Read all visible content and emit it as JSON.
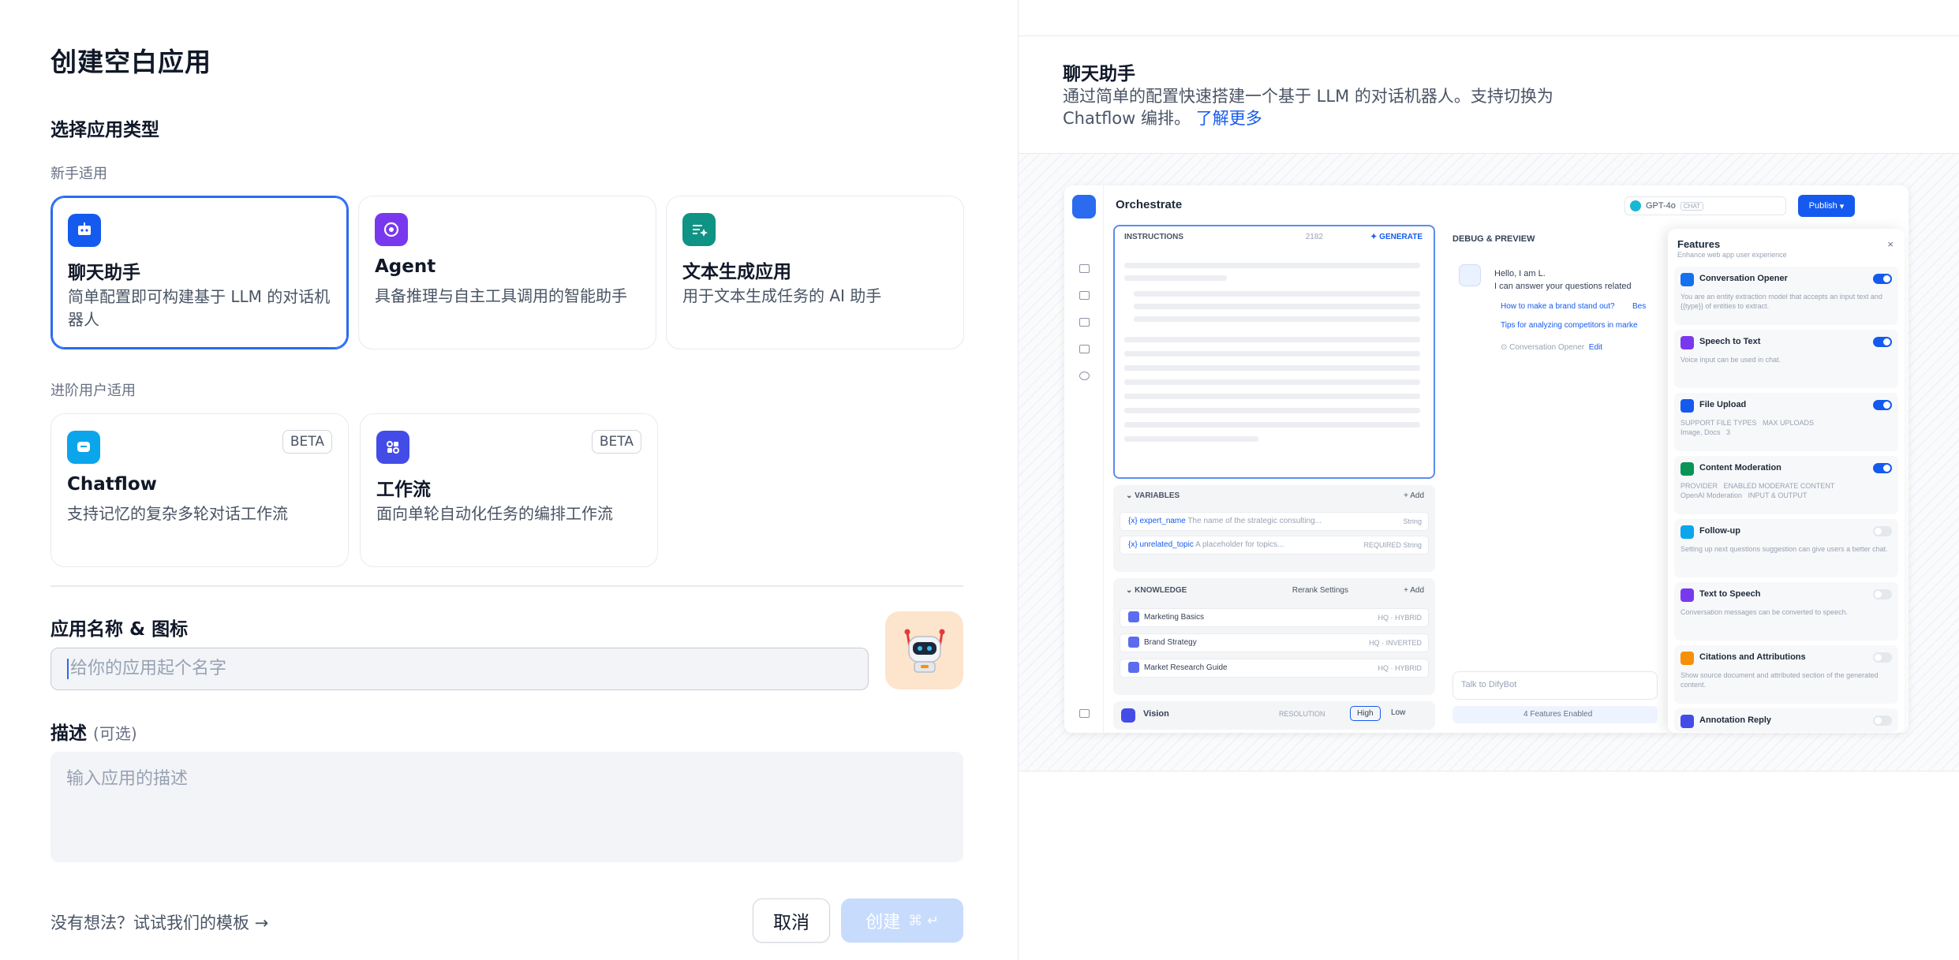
{
  "dialog": {
    "title": "创建空白应用",
    "type_heading": "选择应用类型",
    "group_beginner": "新手适用",
    "group_advanced": "进阶用户适用",
    "beta": "BETA",
    "cards": [
      {
        "title": "聊天助手",
        "desc": "简单配置即可构建基于 LLM 的对话机器人",
        "color": "#155aef",
        "icon": "chat-bot-icon"
      },
      {
        "title": "Agent",
        "desc": "具备推理与自主工具调用的智能助手",
        "color": "#7839ee",
        "icon": "agent-icon"
      },
      {
        "title": "文本生成应用",
        "desc": "用于文本生成任务的 AI 助手",
        "color": "#0e9384",
        "icon": "text-generation-icon"
      },
      {
        "title": "Chatflow",
        "desc": "支持记忆的复杂多轮对话工作流",
        "color": "#0ba5ec",
        "icon": "chatflow-icon"
      },
      {
        "title": "工作流",
        "desc": "面向单轮自动化任务的编排工作流",
        "color": "#444ce7",
        "icon": "workflow-icon"
      }
    ],
    "name_label": "应用名称 & 图标",
    "name_placeholder": "给你的应用起个名字",
    "desc_label": "描述",
    "desc_optional": "(可选)",
    "desc_placeholder": "输入应用的描述",
    "template_link": "没有想法？试试我们的模板",
    "cancel": "取消",
    "create": "创建",
    "create_shortcut": "⌘ ↵"
  },
  "preview": {
    "title": "聊天助手",
    "desc": "通过简单的配置快速搭建一个基于 LLM 的对话机器人。支持切换为 Chatflow 编排。",
    "learn_more": "了解更多",
    "mock": {
      "header_title": "Orchestrate",
      "model": "GPT-4o",
      "model_tag": "CHAT",
      "publish": "Publish",
      "instructions": "INSTRUCTIONS",
      "instructions_count": "2182",
      "generate": "GENERATE",
      "variables": "VARIABLES",
      "add": "+ Add",
      "vars": [
        {
          "key": "{x} expert_name",
          "desc": "The name of the strategic consulting...",
          "type": "String"
        },
        {
          "key": "{x} unrelated_topic",
          "desc": "A placeholder for topics...",
          "type": "String",
          "req": "REQUIRED"
        }
      ],
      "knowledge": "KNOWLEDGE",
      "rerank": "Rerank Settings",
      "kb": [
        {
          "name": "Marketing Basics",
          "tag": "HQ · HYBRID"
        },
        {
          "name": "Brand Strategy",
          "tag": "HQ · INVERTED"
        },
        {
          "name": "Market Research Guide",
          "tag": "HQ · HYBRID"
        }
      ],
      "vision": "Vision",
      "resolution": "RESOLUTION",
      "high": "High",
      "low": "Low",
      "debug": "DEBUG & PREVIEW",
      "hello1": "Hello, I am L.",
      "hello2": "I can answer your questions related",
      "q1": "How to make a brand stand out?",
      "q1b": "Bes",
      "q2": "Tips for analyzing competitors in marke",
      "opener": "Conversation Opener",
      "edit": "Edit",
      "talk": "Talk to DifyBot",
      "enabled": "4 Features Enabled",
      "features_title": "Features",
      "features_sub": "Enhance web app user experience",
      "features": [
        {
          "name": "Conversation Opener",
          "desc": "You are an entity extraction model that accepts an input text and {{type}} of entities to extract.",
          "on": true,
          "color": "#1570ef"
        },
        {
          "name": "Speech to Text",
          "desc": "Voice input can be used in chat.",
          "on": true,
          "color": "#7839ee"
        },
        {
          "name": "File Upload",
          "desc": "SUPPORT FILE TYPES   MAX UPLOADS\nImage, Docs   3",
          "on": true,
          "color": "#155aef"
        },
        {
          "name": "Content Moderation",
          "desc": "PROVIDER   ENABLED MODERATE CONTENT\nOpenAI Moderation   INPUT & OUTPUT",
          "on": true,
          "color": "#079455"
        },
        {
          "name": "Follow-up",
          "desc": "Setting up next questions suggestion can give users a better chat.",
          "on": false,
          "color": "#0ba5ec"
        },
        {
          "name": "Text to Speech",
          "desc": "Conversation messages can be converted to speech.",
          "on": false,
          "color": "#7839ee"
        },
        {
          "name": "Citations and Attributions",
          "desc": "Show source document and attributed section of the generated content.",
          "on": false,
          "color": "#f79009"
        },
        {
          "name": "Annotation Reply",
          "desc": "",
          "on": false,
          "color": "#444ce7"
        }
      ]
    }
  }
}
